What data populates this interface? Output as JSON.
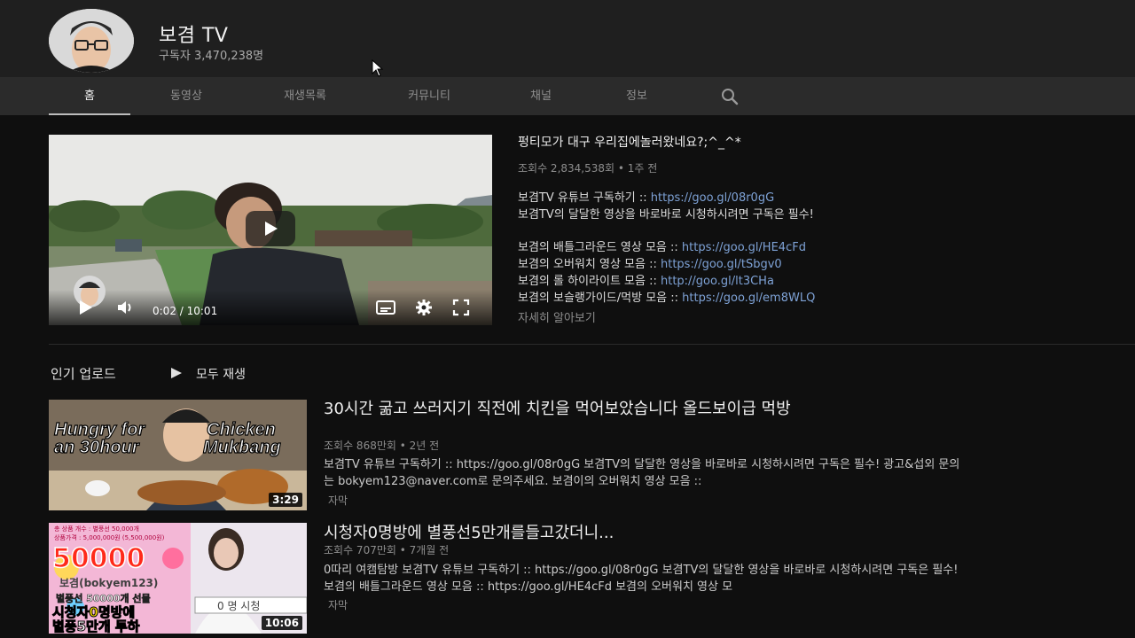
{
  "channel": {
    "name": "보겸 TV",
    "subscribers": "구독자 3,470,238명"
  },
  "tabs": [
    {
      "label": "홈",
      "active": true
    },
    {
      "label": "동영상"
    },
    {
      "label": "재생목록"
    },
    {
      "label": "커뮤니티"
    },
    {
      "label": "채널"
    },
    {
      "label": "정보"
    }
  ],
  "featured": {
    "title": "펑티모가 대구 우리집에놀러왔네요?;^_^*",
    "meta": "조회수 2,834,538회 • 1주 전",
    "time": "0:02 / 10:01",
    "desc": [
      {
        "text": "보겸TV 유튜브 구독하기 :: ",
        "link": "https://goo.gl/08r0gG"
      },
      {
        "text": "보겸TV의 달달한 영상을 바로바로 시청하시려면 구독은 필수!",
        "link": ""
      },
      {
        "text": "보겸의 배틀그라운드 영상 모음 :: ",
        "link": "https://goo.gl/HE4cFd"
      },
      {
        "text": "보겸의 오버워치 영상 모음 :: ",
        "link": "https://goo.gl/tSbgv0"
      },
      {
        "text": "보겸의 롤 하이라이트 모음 :: ",
        "link": "http://goo.gl/lt3CHa"
      },
      {
        "text": "보겸의 보슬랭가이드/먹방 모음 :: ",
        "link": "https://goo.gl/em8WLQ"
      }
    ],
    "more": "자세히 알아보기"
  },
  "popular": {
    "title": "인기 업로드",
    "play_all": "모두 재생",
    "videos": [
      {
        "title": "30시간 굶고 쓰러지기 직전에 치킨을 먹어보았습니다 올드보이급 먹방",
        "meta": "조회수 868만회 • 2년 전",
        "desc": "보겸TV 유튜브 구독하기 :: https://goo.gl/08r0gG 보겸TV의 달달한 영상을 바로바로 시청하시려면 구독은 필수! 광고&섭외 문의는 bokyem123@naver.com로 문의주세요. 보겸이의 오버워치 영상 모음 ::",
        "cc": "자막",
        "duration": "3:29",
        "thumb_lines": [
          "Hungry for",
          "Chicken",
          "an 30hour",
          "Mukbang"
        ]
      },
      {
        "title": "시청자0명방에 별풍선5만개를들고갔더니...",
        "meta": "조회수 707만회 • 7개월 전",
        "desc": "0따리 여캠탐방 보겸TV 유튜브 구독하기 :: https://goo.gl/08r0gG 보겸TV의 달달한 영상을 바로바로 시청하시려면 구독은 필수! 보겸의 배틀그라운드 영상 모음 :: https://goo.gl/HE4cFd 보겸의 오버워치 영상 모",
        "cc": "자막",
        "duration": "10:06",
        "thumb_lines": [
          "총 상품 개수 : 별풍선 50,000개",
          "상품가격 : 5,000,000원 (5,500,000원)",
          "50000",
          "보겸(bokyem123)",
          "별풍선 50000개 선물",
          "시청자0명방에",
          "별풍5만개 투하",
          "0 명 시청"
        ]
      }
    ]
  }
}
